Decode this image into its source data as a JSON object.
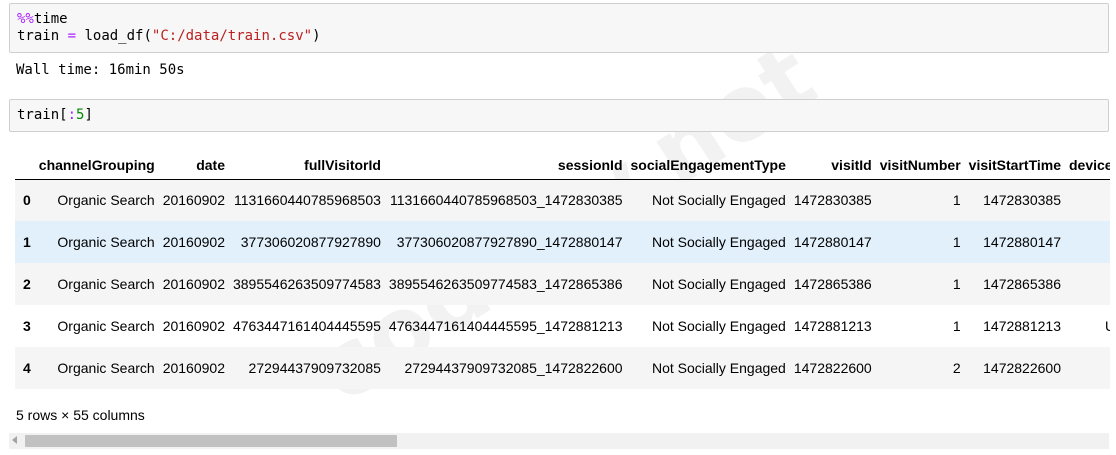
{
  "cell1": {
    "magic": "%%",
    "magic_name": "time",
    "var": "train",
    "op": "=",
    "func": "load_df(",
    "arg": "\"C:/data/train.csv\"",
    "close": ")"
  },
  "cell1_output": "Wall time: 16min 50s",
  "cell2": {
    "var": "train[",
    "slice_colon": ":",
    "slice_num": "5",
    "close": "]"
  },
  "table": {
    "columns": [
      "",
      "channelGrouping",
      "date",
      "fullVisitorId",
      "sessionId",
      "socialEngagementType",
      "visitId",
      "visitNumber",
      "visitStartTime",
      "device"
    ],
    "rows": [
      [
        "0",
        "Organic Search",
        "20160902",
        "1131660440785968503",
        "1131660440785968503_1472830385",
        "Not Socially Engaged",
        "1472830385",
        "1",
        "1472830385",
        ""
      ],
      [
        "1",
        "Organic Search",
        "20160902",
        "377306020877927890",
        "377306020877927890_1472880147",
        "Not Socially Engaged",
        "1472880147",
        "1",
        "1472880147",
        ""
      ],
      [
        "2",
        "Organic Search",
        "20160902",
        "3895546263509774583",
        "3895546263509774583_1472865386",
        "Not Socially Engaged",
        "1472865386",
        "1",
        "1472865386",
        ""
      ],
      [
        "3",
        "Organic Search",
        "20160902",
        "4763447161404445595",
        "4763447161404445595_1472881213",
        "Not Socially Engaged",
        "1472881213",
        "1",
        "1472881213",
        "UC"
      ],
      [
        "4",
        "Organic Search",
        "20160902",
        "27294437909732085",
        "27294437909732085_1472822600",
        "Not Socially Engaged",
        "1472822600",
        "2",
        "1472822600",
        ""
      ]
    ],
    "highlighted_row": 1
  },
  "footer": "5 rows × 55 columns",
  "watermark": "codeby.net"
}
